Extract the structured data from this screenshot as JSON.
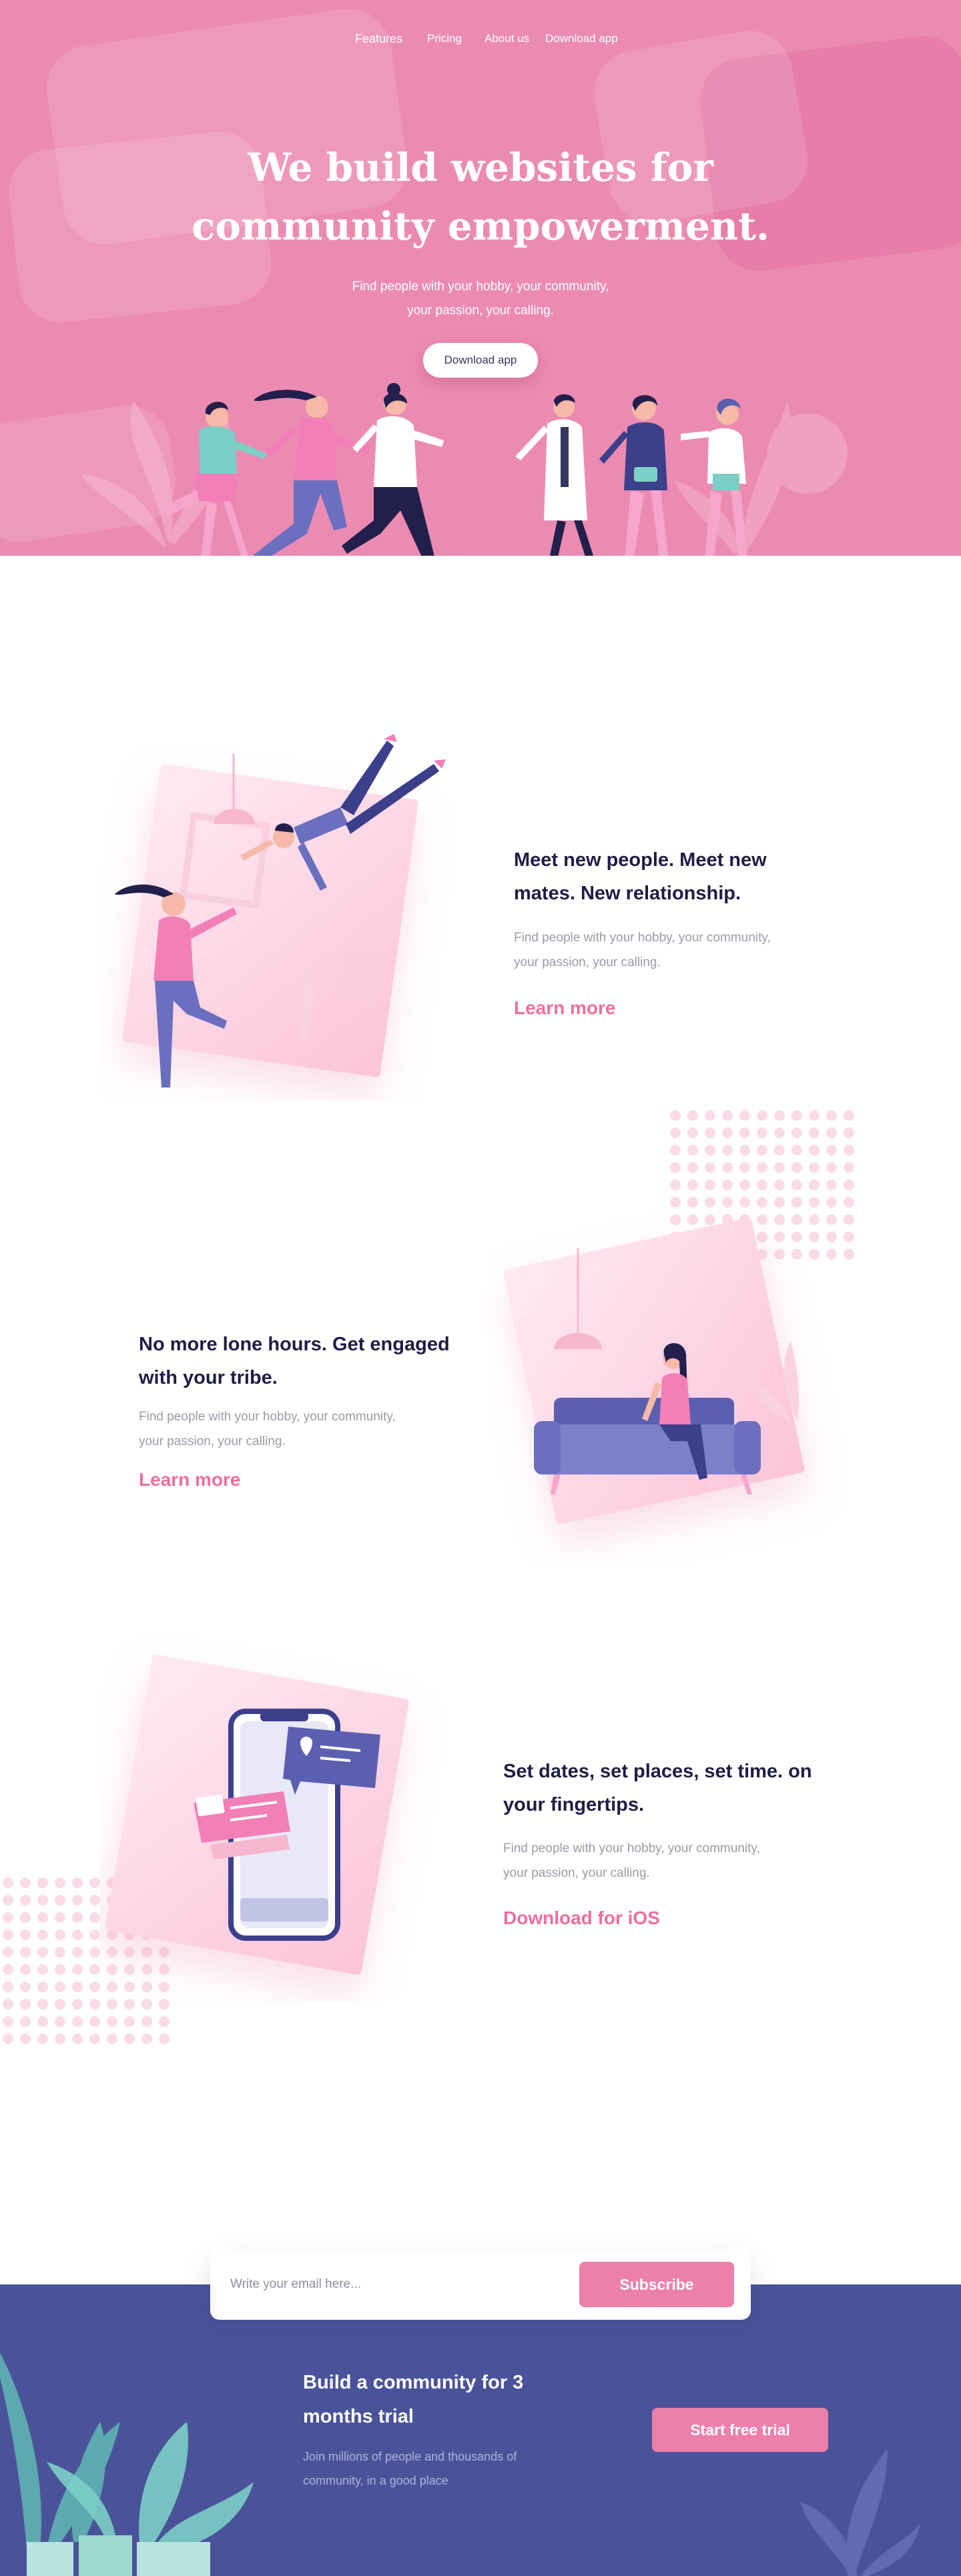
{
  "nav": {
    "items": [
      "Features",
      "Pricing",
      "About us",
      "Download app"
    ]
  },
  "hero": {
    "title_line1": "We build websites for",
    "title_line2": "community empowerment.",
    "subtitle_line1": "Find people with your hobby, your community,",
    "subtitle_line2": "your passion, your calling.",
    "cta_label": "Download app"
  },
  "features": [
    {
      "title_line1": "Meet new people. Meet new",
      "title_line2": "mates. New relationship.",
      "text_line1": "Find people with your hobby, your community,",
      "text_line2": "your passion, your calling.",
      "link_label": "Learn more"
    },
    {
      "title_line1": "No more lone hours. Get engaged",
      "title_line2": "with your tribe.",
      "text_line1": "Find people with your hobby, your community,",
      "text_line2": "your passion, your calling.",
      "link_label": "Learn more"
    },
    {
      "title_line1": "Set dates, set places, set time. on",
      "title_line2": "your fingertips.",
      "text_line1": "Find people with your hobby, your community,",
      "text_line2": "your passion, your calling.",
      "link_label": "Download for iOS"
    }
  ],
  "subscribe": {
    "placeholder": "Write your email here...",
    "button_label": "Subscribe"
  },
  "trial": {
    "title_line1": "Build a community for 3",
    "title_line2": "months trial",
    "text_line1": "Join millions of people and thousands of",
    "text_line2": "community, in a good place",
    "button_label": "Start free trial"
  },
  "colors": {
    "hero_bg": "#ec8bb2",
    "accent_pink": "#ec80a9",
    "footer_bg": "#4a5399",
    "heading_dark": "#1f1d44",
    "body_gray": "#9b9aa8"
  }
}
